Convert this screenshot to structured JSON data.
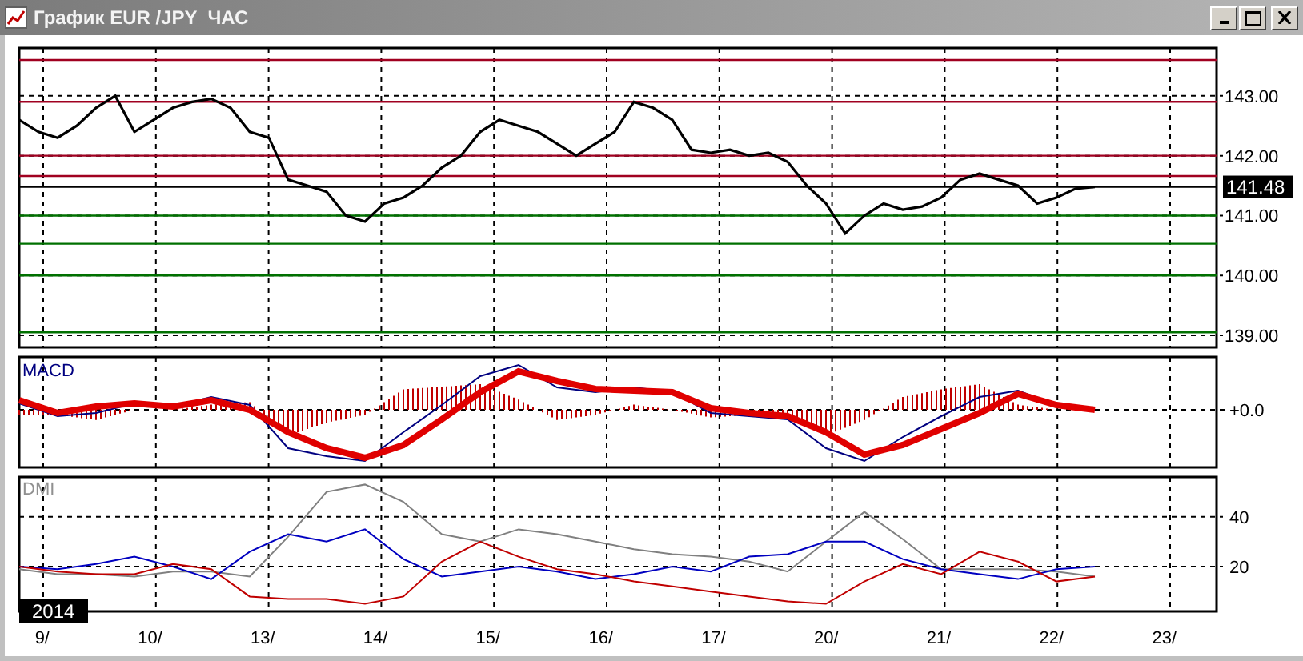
{
  "window": {
    "title": "График EUR /JPY  ЧАС"
  },
  "price": {
    "chart_data": {
      "type": "line",
      "categories": [
        null,
        null,
        null,
        null,
        null,
        null,
        null,
        null,
        null,
        null,
        null,
        null,
        null,
        null,
        null,
        null,
        null,
        null,
        null,
        null,
        null,
        null,
        null,
        null,
        null,
        null,
        null,
        null,
        null,
        null,
        null,
        null,
        null,
        null,
        null,
        null,
        null,
        null,
        null,
        null,
        null,
        null,
        null,
        null,
        null,
        null,
        null,
        null,
        null,
        null,
        null,
        null,
        null,
        null,
        null,
        null,
        null
      ],
      "values": [
        142.6,
        142.4,
        142.3,
        142.5,
        142.8,
        143.0,
        142.4,
        142.6,
        142.8,
        142.9,
        142.95,
        142.8,
        142.4,
        142.3,
        141.6,
        141.5,
        141.4,
        141.0,
        140.9,
        141.2,
        141.3,
        141.5,
        141.8,
        142.0,
        142.4,
        142.6,
        142.5,
        142.4,
        142.2,
        142.0,
        142.2,
        142.4,
        142.9,
        142.8,
        142.6,
        142.1,
        142.05,
        142.1,
        142.0,
        142.05,
        141.9,
        141.5,
        141.2,
        140.7,
        141.0,
        141.2,
        141.1,
        141.15,
        141.3,
        141.6,
        141.7,
        141.6,
        141.5,
        141.2,
        141.3,
        141.45,
        141.48
      ],
      "grid": true,
      "ylim": [
        138.8,
        143.8
      ],
      "yticks": [
        {
          "value": 139,
          "label": "139.00"
        },
        {
          "value": 140,
          "label": "140.00"
        },
        {
          "value": 141,
          "label": "141.00"
        },
        {
          "value": 142,
          "label": "142.00"
        },
        {
          "value": 143,
          "label": "143.00"
        }
      ],
      "ref_lines": [
        {
          "axis": "y",
          "value": 143.6,
          "color": "#a00020"
        },
        {
          "axis": "y",
          "value": 142.9,
          "color": "#a00020"
        },
        {
          "axis": "y",
          "value": 142.0,
          "color": "#a00020"
        },
        {
          "axis": "y",
          "value": 141.66,
          "color": "#a00020"
        },
        {
          "axis": "y",
          "value": 141.48,
          "color": "#000000",
          "label": "141.48"
        },
        {
          "axis": "y",
          "value": 141.0,
          "color": "#007000"
        },
        {
          "axis": "y",
          "value": 140.53,
          "color": "#007000"
        },
        {
          "axis": "y",
          "value": 140.0,
          "color": "#007000"
        },
        {
          "axis": "y",
          "value": 139.05,
          "color": "#007000"
        }
      ]
    }
  },
  "macd": {
    "title": "MACD",
    "zero_label": "+0.0"
  },
  "dmi": {
    "chart_data": {
      "type": "line",
      "title": "DMI",
      "grid": true,
      "categories": [
        null,
        null,
        null,
        null,
        null,
        null,
        null,
        null,
        null,
        null,
        null,
        null,
        null,
        null,
        null,
        null,
        null,
        null,
        null,
        null,
        null,
        null,
        null,
        null,
        null,
        null,
        null,
        null,
        null
      ],
      "ylim": [
        2,
        56
      ],
      "yticks": [
        20,
        40
      ],
      "series": [
        {
          "color": "#808080",
          "values": [
            19,
            17,
            17,
            16,
            18,
            18,
            16,
            32,
            50,
            53,
            46,
            33,
            30,
            35,
            33,
            30,
            27,
            25,
            24,
            22,
            18,
            30,
            42,
            31,
            19,
            19,
            19,
            18,
            16
          ]
        },
        {
          "color": "#0000c0",
          "values": [
            20,
            19,
            21,
            24,
            20,
            15,
            26,
            33,
            30,
            35,
            23,
            16,
            18,
            20,
            18,
            15,
            17,
            20,
            18,
            24,
            25,
            30,
            30,
            23,
            19,
            17,
            15,
            19,
            20
          ]
        },
        {
          "color": "#c00000",
          "values": [
            20,
            18,
            17,
            17,
            21,
            19,
            8,
            7,
            7,
            5,
            8,
            22,
            30,
            24,
            19,
            17,
            14,
            12,
            10,
            8,
            6,
            5,
            14,
            21,
            17,
            26,
            22,
            14,
            16
          ]
        }
      ]
    }
  },
  "time_axis": {
    "labels": [
      "9/",
      "10/",
      "13/",
      "14/",
      "15/",
      "16/",
      "17/",
      "20/",
      "21/",
      "22/",
      "23/"
    ]
  },
  "year_label": "2014"
}
